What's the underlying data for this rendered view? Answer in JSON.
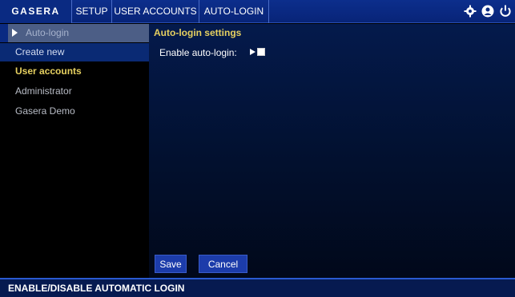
{
  "header": {
    "logo": "GASERA",
    "tabs": [
      {
        "label": "SETUP"
      },
      {
        "label": "USER ACCOUNTS"
      },
      {
        "label": "AUTO-LOGIN"
      }
    ],
    "icons": [
      "gear-icon",
      "user-icon",
      "power-icon"
    ]
  },
  "sidebar": {
    "active_item": "Auto-login",
    "create_new": "Create new",
    "section_header": "User accounts",
    "users": [
      "Administrator",
      "Gasera Demo"
    ]
  },
  "main": {
    "title": "Auto-login settings",
    "enable_label": "Enable auto-login:",
    "enable_checked": false,
    "buttons": {
      "save": "Save",
      "cancel": "Cancel"
    }
  },
  "status": {
    "text": "ENABLE/DISABLE AUTOMATIC LOGIN"
  },
  "colors": {
    "accent_yellow": "#e6d060",
    "nav_blue": "#0c2e8c",
    "button_blue": "#1c3caa"
  }
}
